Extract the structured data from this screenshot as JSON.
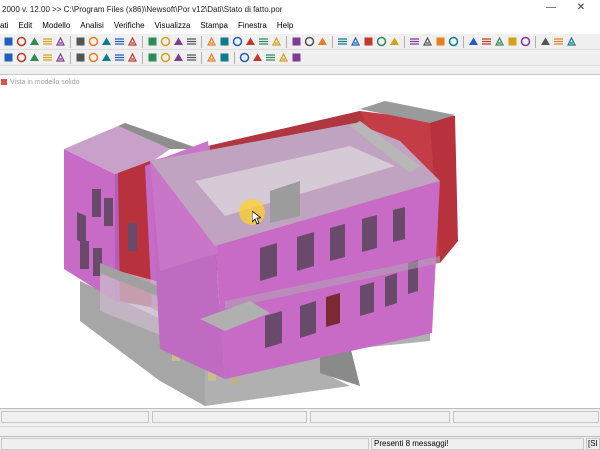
{
  "window": {
    "title": "2000 v. 12.00 >> C:\\Program Files (x86)\\Newsoft\\Por v12\\Dati\\Stato di fatto.por",
    "minimize_glyph": "—",
    "close_glyph": "✕"
  },
  "menu": {
    "items": [
      "ati",
      "Edit",
      "Modello",
      "Analisi",
      "Verifiche",
      "Visualizza",
      "Stampa",
      "Finestra",
      "Help"
    ]
  },
  "toolbar": {
    "row1_icons": [
      "folder-icon",
      "save-icon",
      "print-icon",
      "copy-icon",
      "clipboard-icon",
      "zoom-in-icon",
      "zoom-out-icon",
      "zoom-window-icon",
      "zoom-all-icon",
      "pan-icon",
      "first-icon",
      "prev-icon",
      "next-icon",
      "last-icon",
      "grid-icon",
      "mesh-icon",
      "frame-icon",
      "layers-icon",
      "palette-icon",
      "columns-icon",
      "bars-icon",
      "graph-icon",
      "shear-icon",
      "fill-icon",
      "target-icon",
      "nodes-icon",
      "check-icon",
      "calc-icon",
      "section-icon",
      "stats-icon",
      "chart-icon",
      "info-icon",
      "wall-icon",
      "beam-icon",
      "slab-icon",
      "load-icon",
      "report-icon",
      "settings-icon",
      "verify-icon",
      "export-icon"
    ],
    "row2_icons": [
      "select-icon",
      "select-all-icon",
      "move-icon",
      "rotate-icon",
      "dimension-icon",
      "door-icon",
      "window-icon",
      "stair-icon",
      "column-icon",
      "pillar-icon",
      "line-icon",
      "arc-icon",
      "polyline-icon",
      "node-move-icon",
      "extend-icon",
      "trim-icon",
      "render-icon",
      "wireframe-icon",
      "solid-icon",
      "shade-icon",
      "light-icon"
    ]
  },
  "viewport": {
    "title": "Vista in modello solido"
  },
  "statusbar": {
    "messages": "Presenti 8 messaggi!",
    "right": "[SI"
  },
  "colors": {
    "wall_pink": "#c76bc7",
    "wall_red": "#c43c46",
    "slab_grey": "#a8a8a8",
    "window_dark": "#6a4a6a",
    "highlight": "#ffd228"
  }
}
